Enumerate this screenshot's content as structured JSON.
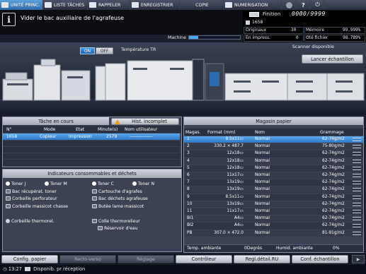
{
  "tabs": [
    {
      "label": "UNITÉ PRINC.",
      "active": true,
      "icon": "home-icon"
    },
    {
      "label": "LISTE TÂCHES",
      "active": false,
      "icon": "job-list-icon"
    },
    {
      "label": "RAPPELER",
      "active": false,
      "icon": "recall-icon"
    },
    {
      "label": "ENREGISTRIER",
      "active": false,
      "icon": "save-icon"
    },
    {
      "label": "COPIE",
      "active": false,
      "icon": "copy-icon"
    },
    {
      "label": "NUMERISATION",
      "active": false,
      "icon": "scan-icon"
    }
  ],
  "tab_icons": {
    "help": "?",
    "power": "power-icon"
  },
  "message": "Vider le bac auxiliaire de l'agrafeuse",
  "counter": {
    "finition_label": "Finition",
    "finition_value": "0000/9999",
    "job_number": "1658",
    "originaux_label": "Originaux",
    "originaux_value": "30",
    "memoire_label": "Mémoire",
    "memoire_value": "99.999%",
    "en_impress_label": "En impress.",
    "en_impress_value": "0",
    "ote_fichier_label": "Oté fichier",
    "ote_fichier_value": "98.789%"
  },
  "machine": {
    "label": "Machine",
    "progress": 0.18
  },
  "temperature": {
    "on": "ON",
    "off": "OFF",
    "label": "Température TR",
    "state": "on"
  },
  "scanner_status": "Scanner disponible",
  "sample_button": "Lancer échantillon",
  "tasks": {
    "title": "Tâche en cours",
    "hist_button": "Hist. incomplet",
    "columns": [
      "N°",
      "Mode",
      "Etat",
      "Minute(s)",
      "Nom utilisateur"
    ],
    "rows": [
      {
        "no": "1658",
        "mode": "Copieur",
        "etat": "Impression",
        "minutes": "2579",
        "user": "---------------"
      }
    ]
  },
  "consumables": {
    "title": "Indicateurs consommables et déchets",
    "items": {
      "toner_j": "Toner J",
      "toner_m": "Toner M",
      "toner_c": "Toner C",
      "toner_n": "Toner N",
      "bac_toner": "Bac récupérat. toner",
      "cartouche": "Cartouche d'agrafes",
      "corbeille_perf": "Corbeille perforateur",
      "bac_dechets": "Bac déchets agrafeuse",
      "corbeille_massicot": "Corbeille massicot chasse",
      "butee": "Butée lame massicot",
      "corbeille_thermo": "Corbeille thermorel.",
      "colle": "Colle thermorelieur",
      "reservoir": "Réservoir d'eau"
    }
  },
  "trays": {
    "title": "Magasin papier",
    "columns": [
      "Magas.",
      "Format (mm)",
      "Nom",
      "Grammage"
    ],
    "rows": [
      {
        "tray": "1",
        "format": "8.5x11▭",
        "name": "Normal",
        "weight": "62-74g/m2"
      },
      {
        "tray": "2",
        "format": "330.2 × 487.7",
        "name": "Normal",
        "weight": "75-80g/m2"
      },
      {
        "tray": "3",
        "format": "12x18▭",
        "name": "Normal",
        "weight": "62-74g/m2"
      },
      {
        "tray": "4",
        "format": "12x18▭",
        "name": "Normal",
        "weight": "62-74g/m2"
      },
      {
        "tray": "5",
        "format": "12x18▭",
        "name": "Normal",
        "weight": "62-74g/m2"
      },
      {
        "tray": "6",
        "format": "11x17▭",
        "name": "Normal",
        "weight": "62-74g/m2"
      },
      {
        "tray": "7",
        "format": "13x19▭",
        "name": "Normal",
        "weight": "62-74g/m2"
      },
      {
        "tray": "8",
        "format": "13x19▭",
        "name": "Normal",
        "weight": "62-74g/m2"
      },
      {
        "tray": "9",
        "format": "8.5x11▭",
        "name": "Normal",
        "weight": "62-74g/m2"
      },
      {
        "tray": "10",
        "format": "13x19▭",
        "name": "Normal",
        "weight": "62-74g/m2"
      },
      {
        "tray": "11",
        "format": "11x17▭",
        "name": "Normal",
        "weight": "62-74g/m2"
      },
      {
        "tray": "BI1",
        "format": "A4▭",
        "name": "Normal",
        "weight": "62-74g/m2"
      },
      {
        "tray": "BI2",
        "format": "A4▭",
        "name": "Normal",
        "weight": "62-74g/m2"
      },
      {
        "tray": "PB",
        "format": "307.0 × 472.0",
        "name": "Normal",
        "weight": "81-91g/m2"
      }
    ],
    "temp_label": "Temp. ambiante",
    "temp_value": "0Degrés",
    "humid_label": "Humid. ambiante",
    "humid_value": "0%"
  },
  "bottom": {
    "config_papier": "Config. papier",
    "recto_verso": "Recto-verso",
    "reglage": "Réglage",
    "controleur": "Contrôleur",
    "regl_detail": "Regl.détail.RU",
    "conf_echantillon": "Conf. échantillon"
  },
  "status": {
    "time": "13:27",
    "text": "Disponib. pr réception"
  }
}
